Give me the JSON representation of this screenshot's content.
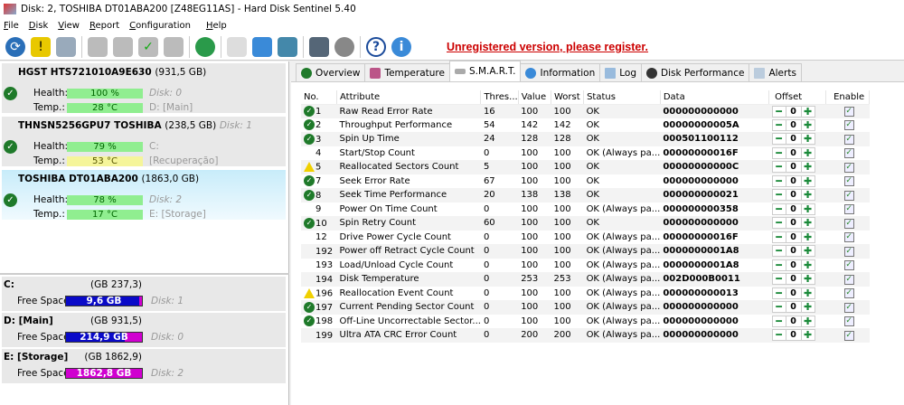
{
  "window": {
    "title": "Disk: 2, TOSHIBA DT01ABA200 [Z48EG11AS]  -  Hard Disk Sentinel 5.40"
  },
  "menu": [
    "File",
    "Disk",
    "View",
    "Report",
    "Configuration",
    "Help"
  ],
  "toolbar": {
    "unregistered": "Unregistered version, please register."
  },
  "disks": [
    {
      "name": "HGST HTS721010A9E630",
      "size": "(931,5 GB)",
      "disk_label": "",
      "health_label": "Health:",
      "health": "100 %",
      "health_value": 100,
      "temp_label": "Temp.:",
      "temp": "28 °C",
      "side1": "Disk: 0",
      "side2": "D: [Main]"
    },
    {
      "name": "THNSN5256GPU7 TOSHIBA",
      "size": "(238,5 GB)",
      "disk_label": "Disk: 1",
      "health_label": "Health:",
      "health": "79 %",
      "health_value": 79,
      "temp_label": "Temp.:",
      "temp": "53 °C",
      "side1": "C:",
      "side2": "[Recuperação]"
    },
    {
      "name": "TOSHIBA DT01ABA200",
      "size": "(1863,0 GB)",
      "disk_label": "",
      "health_label": "Health:",
      "health": "78 %",
      "health_value": 78,
      "temp_label": "Temp.:",
      "temp": "17 °C",
      "side1": "Disk: 2",
      "side2": "E: [Storage]"
    }
  ],
  "partitions": [
    {
      "name": "C:",
      "size": "(237,3 GB)",
      "free_label": "Free Space",
      "free": "9,6 GB",
      "used_percent": 96,
      "disk": "Disk: 1"
    },
    {
      "name": "D: [Main]",
      "size": "(931,5 GB)",
      "free_label": "Free Space",
      "free": "214,9 GB",
      "used_percent": 77,
      "disk": "Disk: 0"
    },
    {
      "name": "E: [Storage]",
      "size": "(1862,9 GB)",
      "free_label": "Free Space",
      "free": "1862,8 GB",
      "used_percent": 0,
      "disk": "Disk: 2"
    }
  ],
  "tabs": [
    "Overview",
    "Temperature",
    "S.M.A.R.T.",
    "Information",
    "Log",
    "Disk Performance",
    "Alerts"
  ],
  "smart": {
    "headers": [
      "No.",
      "Attribute",
      "Thres...",
      "Value",
      "Worst",
      "Status",
      "Data",
      "Offset",
      "Enable"
    ],
    "rows": [
      {
        "icon": "ok",
        "no": "1",
        "attr": "Raw Read Error Rate",
        "thr": "16",
        "val": "100",
        "worst": "100",
        "status": "OK",
        "data": "000000000000",
        "offset": "0"
      },
      {
        "icon": "ok",
        "no": "2",
        "attr": "Throughput Performance",
        "thr": "54",
        "val": "142",
        "worst": "142",
        "status": "OK",
        "data": "00000000005A",
        "offset": "0"
      },
      {
        "icon": "ok",
        "no": "3",
        "attr": "Spin Up Time",
        "thr": "24",
        "val": "128",
        "worst": "128",
        "status": "OK",
        "data": "000501100112",
        "offset": "0"
      },
      {
        "icon": "none",
        "no": "4",
        "attr": "Start/Stop Count",
        "thr": "0",
        "val": "100",
        "worst": "100",
        "status": "OK (Always pa...",
        "data": "00000000016F",
        "offset": "0"
      },
      {
        "icon": "warn",
        "no": "5",
        "attr": "Reallocated Sectors Count",
        "thr": "5",
        "val": "100",
        "worst": "100",
        "status": "OK",
        "data": "00000000000C",
        "offset": "0"
      },
      {
        "icon": "ok",
        "no": "7",
        "attr": "Seek Error Rate",
        "thr": "67",
        "val": "100",
        "worst": "100",
        "status": "OK",
        "data": "000000000000",
        "offset": "0"
      },
      {
        "icon": "ok",
        "no": "8",
        "attr": "Seek Time Performance",
        "thr": "20",
        "val": "138",
        "worst": "138",
        "status": "OK",
        "data": "000000000021",
        "offset": "0"
      },
      {
        "icon": "none",
        "no": "9",
        "attr": "Power On Time Count",
        "thr": "0",
        "val": "100",
        "worst": "100",
        "status": "OK (Always pa...",
        "data": "000000000358",
        "offset": "0"
      },
      {
        "icon": "ok",
        "no": "10",
        "attr": "Spin Retry Count",
        "thr": "60",
        "val": "100",
        "worst": "100",
        "status": "OK",
        "data": "000000000000",
        "offset": "0"
      },
      {
        "icon": "none",
        "no": "12",
        "attr": "Drive Power Cycle Count",
        "thr": "0",
        "val": "100",
        "worst": "100",
        "status": "OK (Always pa...",
        "data": "00000000016F",
        "offset": "0"
      },
      {
        "icon": "none",
        "no": "192",
        "attr": "Power off Retract Cycle Count",
        "thr": "0",
        "val": "100",
        "worst": "100",
        "status": "OK (Always pa...",
        "data": "0000000001A8",
        "offset": "0"
      },
      {
        "icon": "none",
        "no": "193",
        "attr": "Load/Unload Cycle Count",
        "thr": "0",
        "val": "100",
        "worst": "100",
        "status": "OK (Always pa...",
        "data": "0000000001A8",
        "offset": "0"
      },
      {
        "icon": "none",
        "no": "194",
        "attr": "Disk Temperature",
        "thr": "0",
        "val": "253",
        "worst": "253",
        "status": "OK (Always pa...",
        "data": "002D000B0011",
        "offset": "0"
      },
      {
        "icon": "warn",
        "no": "196",
        "attr": "Reallocation Event Count",
        "thr": "0",
        "val": "100",
        "worst": "100",
        "status": "OK (Always pa...",
        "data": "000000000013",
        "offset": "0"
      },
      {
        "icon": "ok",
        "no": "197",
        "attr": "Current Pending Sector Count",
        "thr": "0",
        "val": "100",
        "worst": "100",
        "status": "OK (Always pa...",
        "data": "000000000000",
        "offset": "0"
      },
      {
        "icon": "ok",
        "no": "198",
        "attr": "Off-Line Uncorrectable Sector...",
        "thr": "0",
        "val": "100",
        "worst": "100",
        "status": "OK (Always pa...",
        "data": "000000000000",
        "offset": "0"
      },
      {
        "icon": "none",
        "no": "199",
        "attr": "Ultra ATA CRC Error Count",
        "thr": "0",
        "val": "200",
        "worst": "200",
        "status": "OK (Always pa...",
        "data": "000000000000",
        "offset": "0"
      }
    ]
  }
}
